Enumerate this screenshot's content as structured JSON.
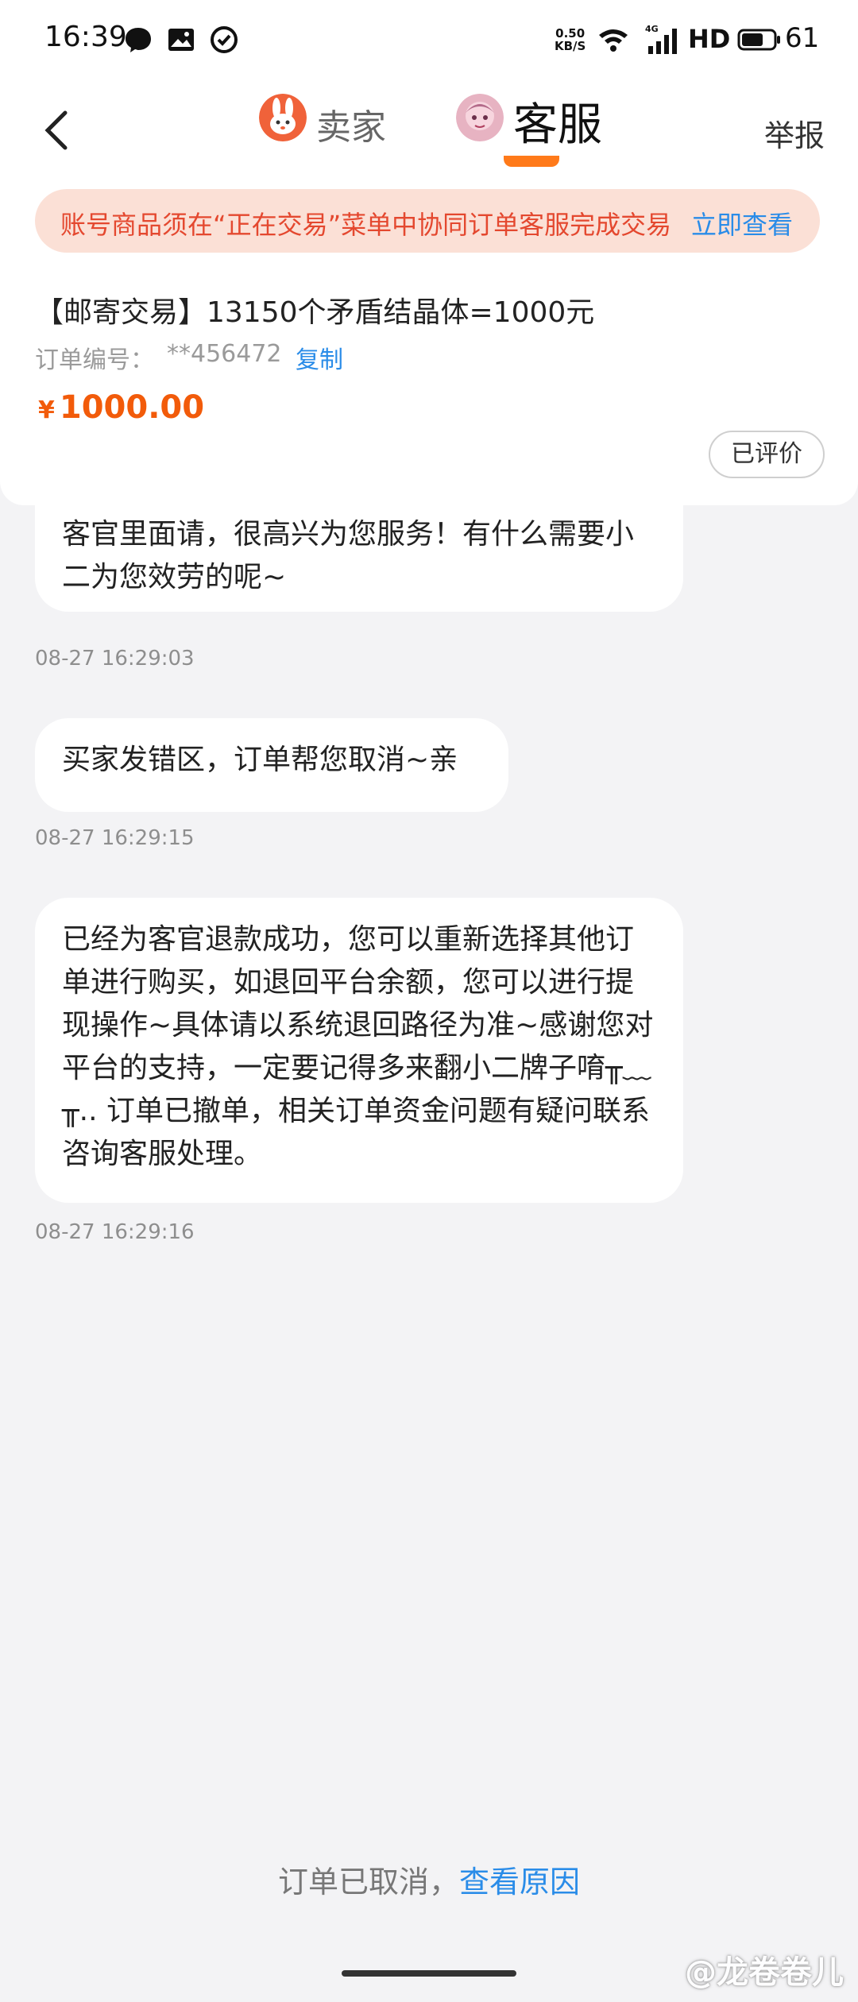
{
  "status_bar": {
    "time": "16:39",
    "net_speed_value": "0.50",
    "net_speed_unit": "KB/S",
    "hd": "HD",
    "battery": "61"
  },
  "header": {
    "tabs": [
      {
        "label": "卖家",
        "active": false
      },
      {
        "label": "客服",
        "active": true
      }
    ],
    "report_label": "举报",
    "accent_color": "#ff7a1a"
  },
  "notice": {
    "text": "账号商品须在“正在交易”菜单中协同订单客服完成交易",
    "link": "立即查看"
  },
  "order": {
    "title": "【邮寄交易】13150个矛盾结晶体=1000元",
    "number_label": "订单编号：",
    "number_value": "**456472",
    "copy_label": "复制",
    "currency": "¥",
    "price": "1000.00",
    "rated_label": "已评价"
  },
  "messages": [
    {
      "text": "客官里面请，很高兴为您服务！有什么需要小二为您效劳的呢~",
      "time": "08-27 16:29:03"
    },
    {
      "text": "买家发错区，订单帮您取消~亲",
      "time": "08-27 16:29:15"
    },
    {
      "text": "已经为客官退款成功，您可以重新选择其他订单进行购买，如退回平台余额，您可以进行提现操作~具体请以系统退回路径为准~感谢您对平台的支持，一定要记得多来翻小二牌子唷╥﹏╥.. 订单已撤单，相关订单资金问题有疑问联系咨询客服处理。",
      "time": "08-27 16:29:16"
    }
  ],
  "footer": {
    "cancel_text": "订单已取消，",
    "cancel_link": "查看原因",
    "watermark": "@龙卷卷儿"
  }
}
